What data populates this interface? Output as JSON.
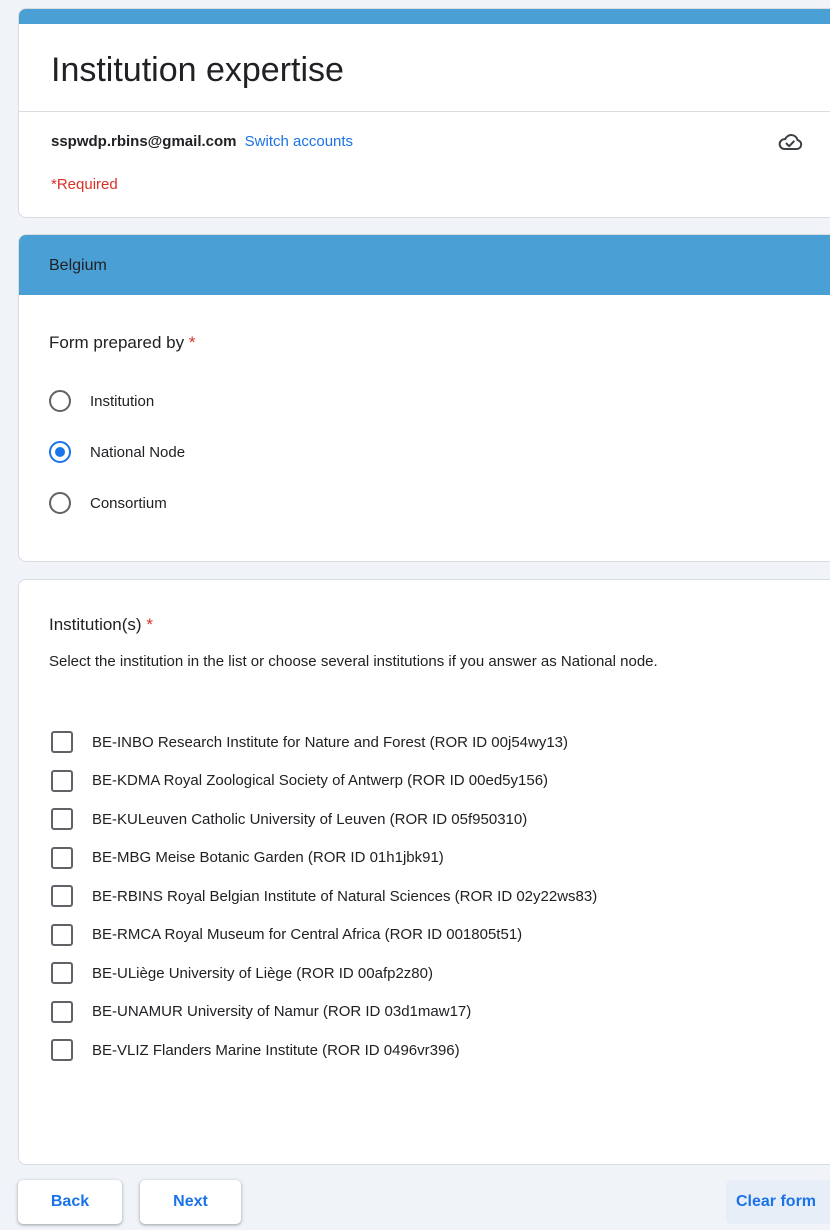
{
  "form": {
    "title": "Institution expertise",
    "account_email": "sspwdp.rbins@gmail.com",
    "switch_accounts": "Switch accounts",
    "required_note": "*Required",
    "accent_color": "#4aa0d5"
  },
  "section": {
    "title": "Belgium",
    "question": "Form prepared by",
    "required_mark": "*",
    "options": [
      {
        "label": "Institution",
        "selected": false
      },
      {
        "label": "National Node",
        "selected": true
      },
      {
        "label": "Consortium",
        "selected": false
      }
    ]
  },
  "institutions": {
    "question": "Institution(s)",
    "required_mark": "*",
    "description": "Select the institution in the list or choose several institutions if you answer as National node.",
    "options": [
      {
        "label": "BE-INBO Research Institute for Nature and Forest (ROR ID 00j54wy13)",
        "checked": false
      },
      {
        "label": "BE-KDMA Royal Zoological Society of Antwerp (ROR ID 00ed5y156)",
        "checked": false
      },
      {
        "label": "BE-KULeuven Catholic University of Leuven (ROR ID 05f950310)",
        "checked": false
      },
      {
        "label": "BE-MBG Meise Botanic Garden (ROR ID 01h1jbk91)",
        "checked": false
      },
      {
        "label": "BE-RBINS Royal Belgian Institute of Natural Sciences (ROR ID 02y22ws83)",
        "checked": false
      },
      {
        "label": "BE-RMCA Royal Museum for Central Africa (ROR ID 001805t51)",
        "checked": false
      },
      {
        "label": "BE-ULiège University of Liège (ROR ID 00afp2z80)",
        "checked": false
      },
      {
        "label": "BE-UNAMUR University of Namur (ROR ID 03d1maw17)",
        "checked": false
      },
      {
        "label": "BE-VLIZ Flanders Marine Institute (ROR ID 0496vr396)",
        "checked": false
      }
    ]
  },
  "buttons": {
    "back": "Back",
    "next": "Next",
    "clear": "Clear form"
  },
  "icons": {
    "save_status": "cloud-check-icon"
  }
}
